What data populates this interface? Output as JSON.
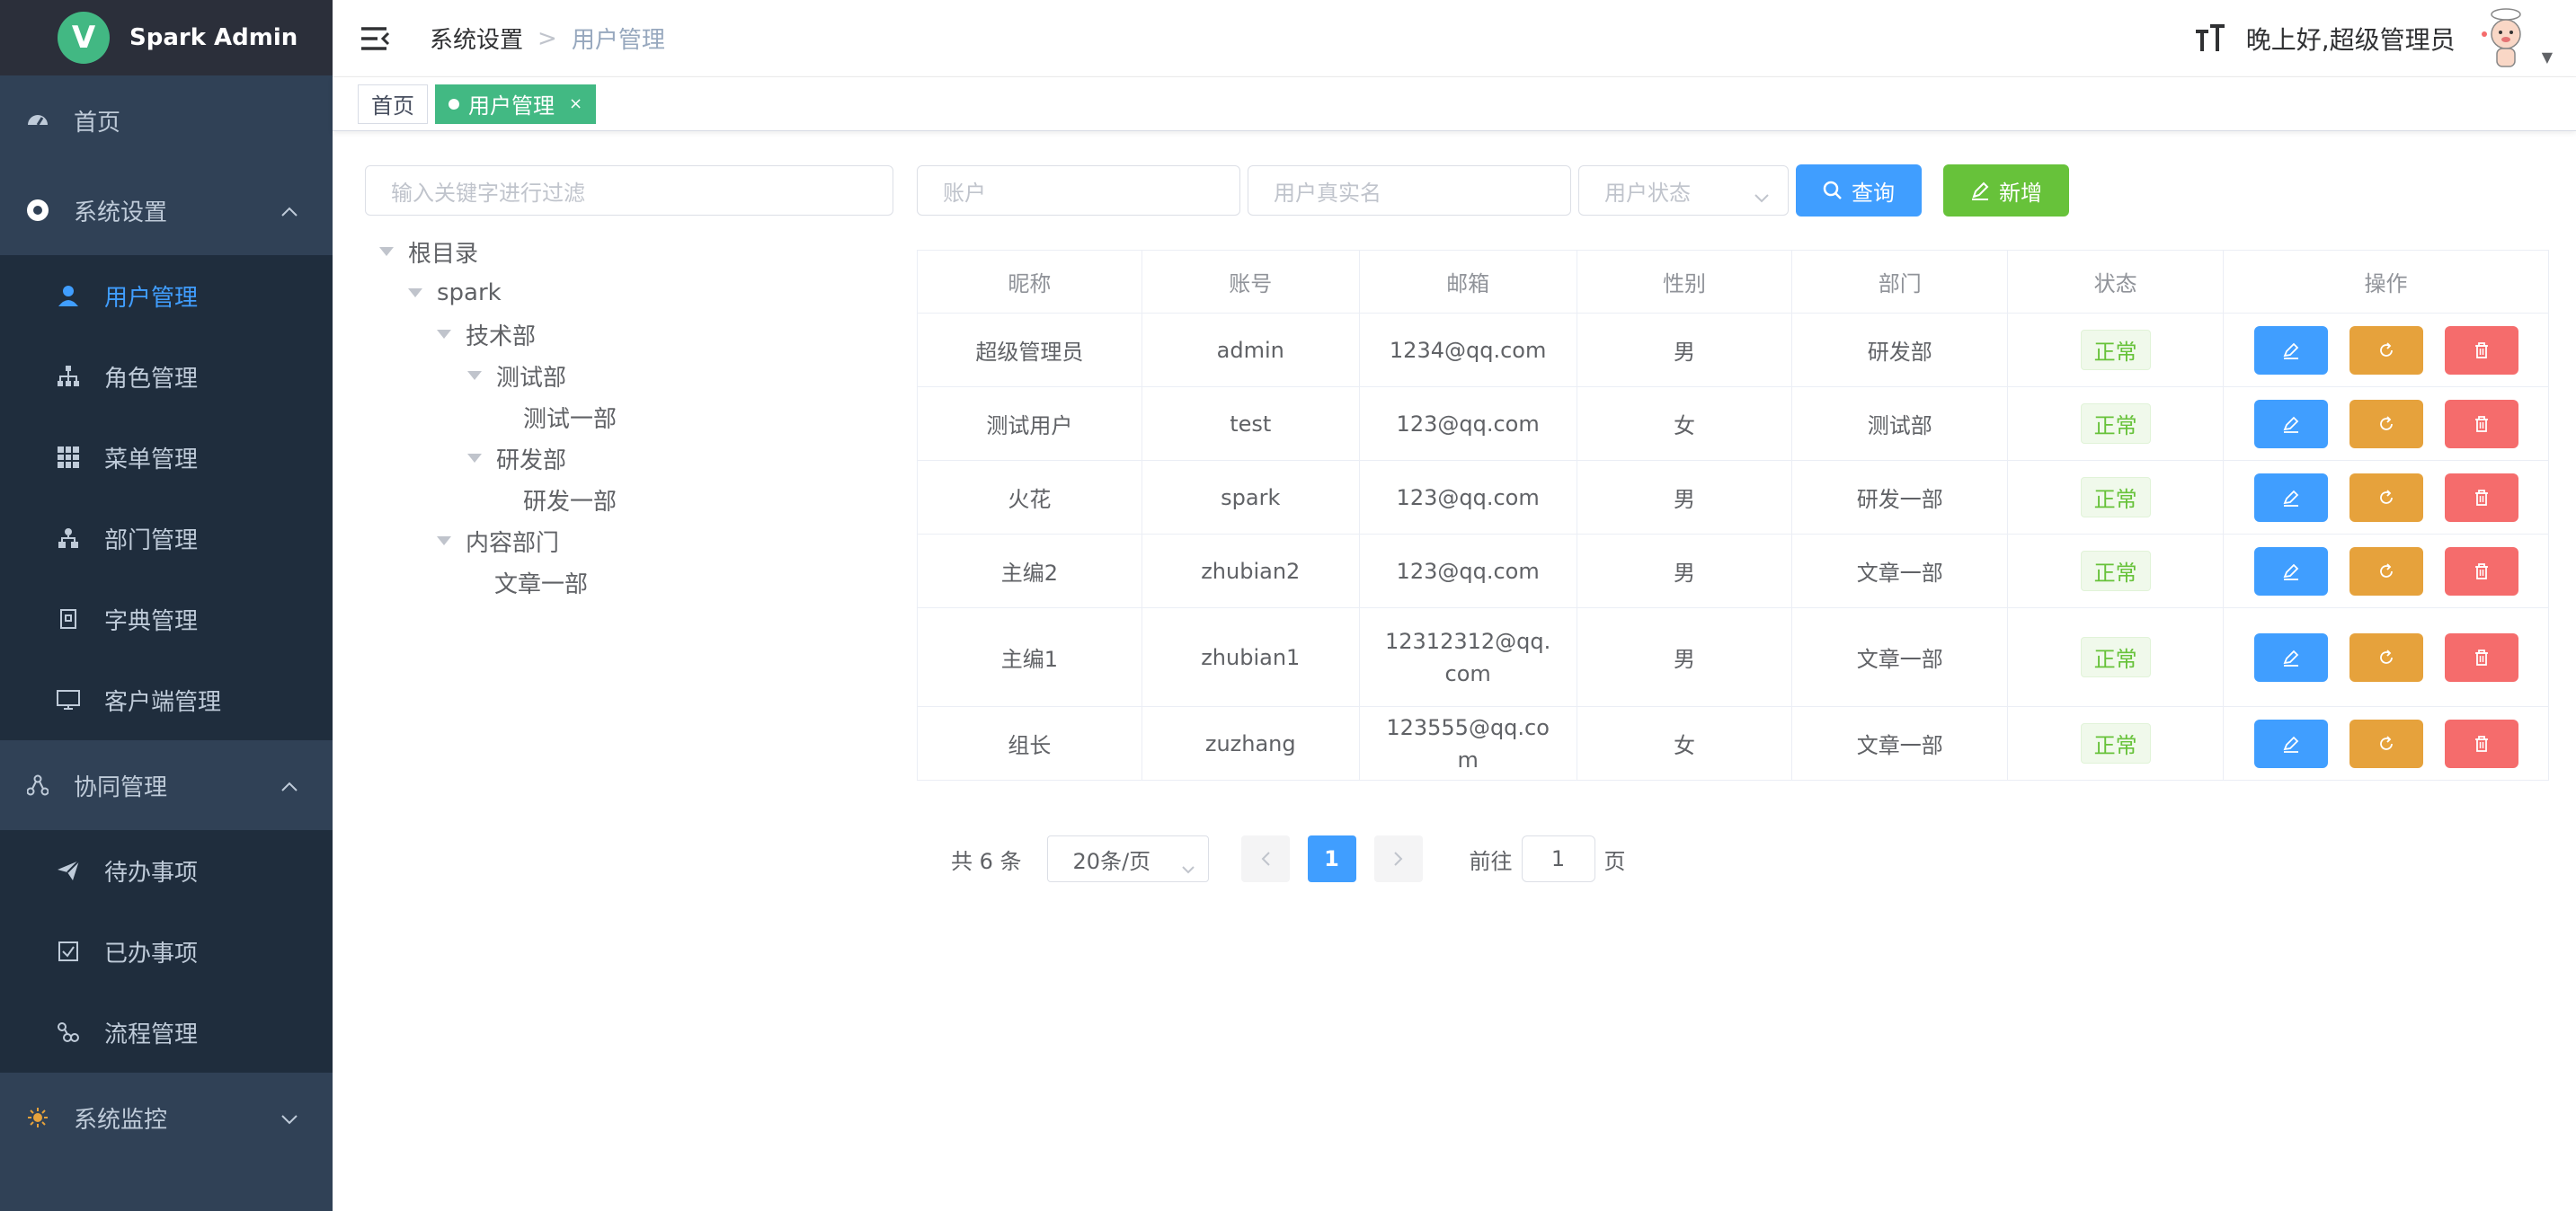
{
  "app": {
    "title": "Spark Admin",
    "logo_letter": "V"
  },
  "sidebar": {
    "home": "首页",
    "system_settings": "系统设置",
    "system_items": [
      "用户管理",
      "角色管理",
      "菜单管理",
      "部门管理",
      "字典管理",
      "客户端管理"
    ],
    "collab": "协同管理",
    "collab_items": [
      "待办事项",
      "已办事项",
      "流程管理"
    ],
    "monitor": "系统监控"
  },
  "header": {
    "breadcrumb": [
      "系统设置",
      "用户管理"
    ],
    "breadcrumb_sep": ">",
    "greeting": "晚上好,超级管理员"
  },
  "tags": [
    "首页",
    "用户管理"
  ],
  "tag_close": "×",
  "filter": {
    "tree_placeholder": "输入关键字进行过滤",
    "account_placeholder": "账户",
    "realname_placeholder": "用户真实名",
    "status_placeholder": "用户状态",
    "query_label": "查询",
    "add_label": "新增"
  },
  "tree": {
    "root": "根目录",
    "spark": "spark",
    "tech": "技术部",
    "test": "测试部",
    "test1": "测试一部",
    "dev": "研发部",
    "dev1": "研发一部",
    "content": "内容部门",
    "article1": "文章一部"
  },
  "table": {
    "columns": [
      "昵称",
      "账号",
      "邮箱",
      "性别",
      "部门",
      "状态",
      "操作"
    ],
    "rows": [
      [
        "超级管理员",
        "admin",
        "1234@qq.com",
        "男",
        "研发部",
        "正常"
      ],
      [
        "测试用户",
        "test",
        "123@qq.com",
        "女",
        "测试部",
        "正常"
      ],
      [
        "火花",
        "spark",
        "123@qq.com",
        "男",
        "研发一部",
        "正常"
      ],
      [
        "主编2",
        "zhubian2",
        "123@qq.com",
        "男",
        "文章一部",
        "正常"
      ],
      [
        "主编1",
        "zhubian1",
        "12312312@qq.com",
        "男",
        "文章一部",
        "正常"
      ],
      [
        "组长",
        "zuzhang",
        "123555@qq.com",
        "女",
        "文章一部",
        "正常"
      ]
    ]
  },
  "pagination": {
    "total": "共 6 条",
    "page_size": "20条/页",
    "current": "1",
    "goto_prefix": "前往",
    "goto_value": "1",
    "goto_suffix": "页"
  },
  "colors": {
    "sidebar_bg": "#304156",
    "submenu_bg": "#1f2d3d",
    "active_text": "#409eff",
    "tag_active": "#42b983",
    "primary": "#409eff",
    "success": "#67c23a",
    "warning": "#e6a23c",
    "danger": "#f56c6c"
  }
}
